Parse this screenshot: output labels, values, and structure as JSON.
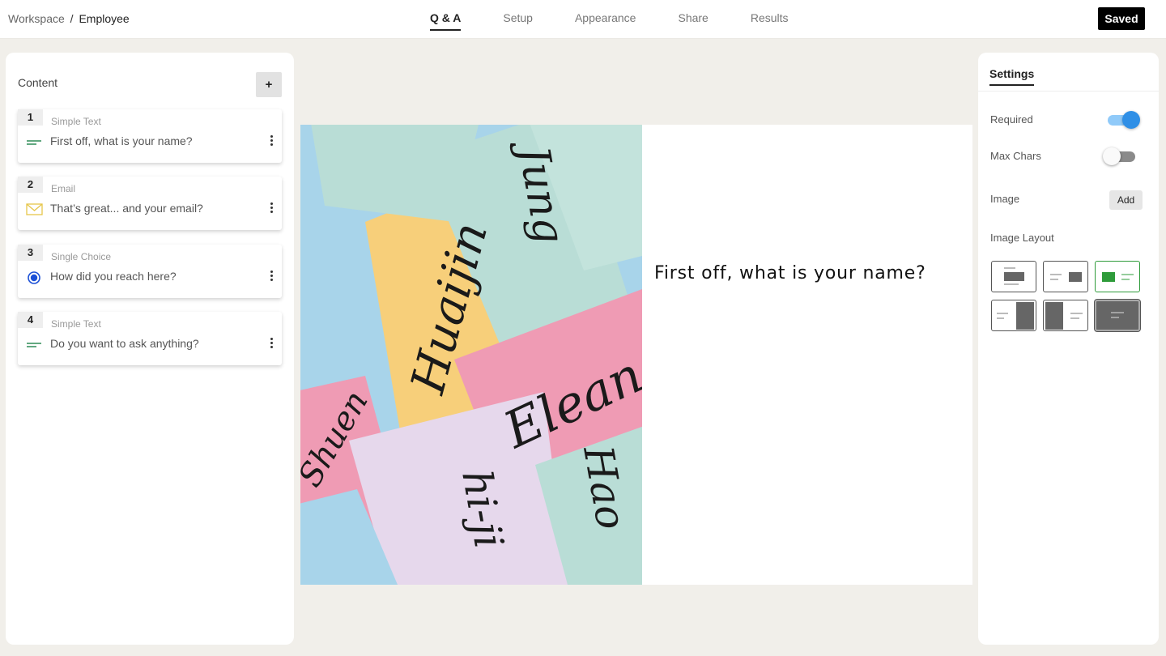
{
  "breadcrumb": {
    "workspace": "Workspace",
    "separator": "/",
    "page": "Employee"
  },
  "tabs": [
    {
      "label": "Q & A",
      "active": true
    },
    {
      "label": "Setup",
      "active": false
    },
    {
      "label": "Appearance",
      "active": false
    },
    {
      "label": "Share",
      "active": false
    },
    {
      "label": "Results",
      "active": false
    }
  ],
  "status_button": "Saved",
  "content_panel": {
    "title": "Content",
    "add_label": "+",
    "questions": [
      {
        "number": "1",
        "type": "Simple Text",
        "text": "First off, what is your name?",
        "icon": "short-text-icon"
      },
      {
        "number": "2",
        "type": "Email",
        "text": "That’s great... and your email?",
        "icon": "envelope-icon"
      },
      {
        "number": "3",
        "type": "Single Choice",
        "text": "How did you reach here?",
        "icon": "radio-icon"
      },
      {
        "number": "4",
        "type": "Simple Text",
        "text": "Do you want to ask anything?",
        "icon": "short-text-icon"
      }
    ]
  },
  "preview": {
    "question": "First off, what is your name?",
    "image_words": [
      "Huaijin",
      "Shuen",
      "Elean",
      "Jung",
      "hi-ji",
      "Hao"
    ]
  },
  "settings": {
    "tab": "Settings",
    "required_label": "Required",
    "required_on": true,
    "max_chars_label": "Max Chars",
    "max_chars_on": false,
    "image_label": "Image",
    "image_add": "Add",
    "layout_label": "Image Layout",
    "selected_layout_index": 2
  },
  "colors": {
    "accent_blue": "#2f8fe6",
    "selected_green": "#2e9b3a",
    "note_teal": "#b9ddd6",
    "note_yellow": "#f7cf7a",
    "note_pink": "#ef9bb4",
    "note_lilac": "#e6d8ec",
    "note_blue": "#a8d4ea"
  }
}
